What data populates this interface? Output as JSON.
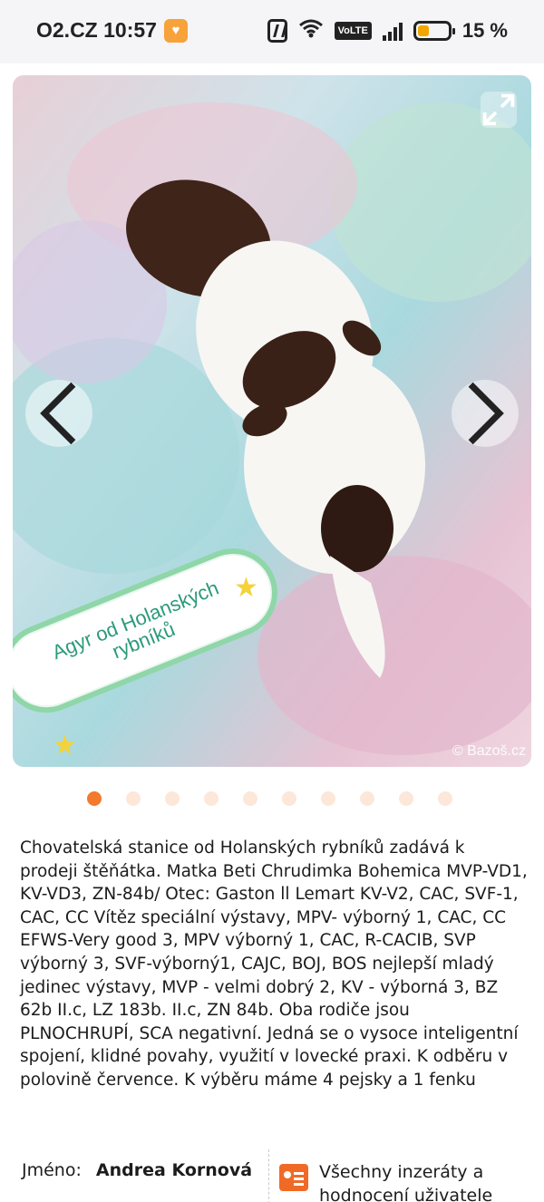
{
  "status_bar": {
    "carrier_time": "O2.CZ 10:57",
    "battery_percent": "15 %",
    "volte_label": "VoLTE",
    "icons": [
      "heart-badge-icon",
      "nfc-icon",
      "wifi-icon",
      "volte-icon",
      "signal-icon",
      "battery-icon"
    ]
  },
  "gallery": {
    "banner_text": "Agyr od Holanských rybníků",
    "watermark": "© Bazoš.cz",
    "image_count": 10,
    "active_index": 0,
    "icons": [
      "expand-icon",
      "chevron-left-icon",
      "chevron-right-icon"
    ]
  },
  "description": "Chovatelská stanice od Holanských rybníků zadává k prodeji štěňátka. Matka Beti Chrudimka Bohemica MVP-VD1, KV-VD3, ZN-84b/ Otec: Gaston ll Lemart KV-V2, CAC, SVF-1, CAC, CC Vítěz speciální výstavy, MPV- výborný 1, CAC, CC EFWS-Very good 3, MPV výborný 1, CAC, R-CACIB, SVP výborný 3, SVF-výborný1, CAJC, BOJ, BOS nejlepší mladý jedinec výstavy, MVP - velmi dobrý 2, KV - výborná 3, BZ 62b II.c, LZ 183b. II.c, ZN 84b. Oba rodiče jsou PLNOCHRUPÍ, SCA negativní. Jedná se o vysoce inteligentní spojení, klidné povahy, využití v lovecké praxi. K odběru v polovině července. K výběru máme 4 pejsky a 1 fenku",
  "seller": {
    "label": "Jméno:",
    "name": "Andrea Kornová"
  },
  "user_link": {
    "text": "Všechny inzeráty a hodnocení uživatele"
  },
  "colors": {
    "accent": "#f3792c",
    "dot_inactive": "#fde7d9",
    "banner_green": "#8fd6a8"
  }
}
